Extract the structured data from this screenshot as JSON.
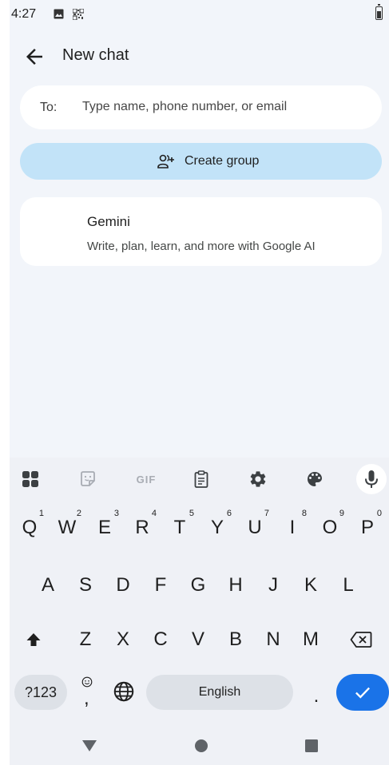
{
  "status_bar": {
    "time": "4:27",
    "icons": [
      "image-icon",
      "qr-code-icon",
      "battery-icon"
    ]
  },
  "app_bar": {
    "title": "New chat",
    "back_icon": "arrow-back-icon"
  },
  "recipient": {
    "label": "To:",
    "value": "",
    "placeholder": "Type name, phone number, or email"
  },
  "create_group": {
    "label": "Create group",
    "icon": "group-add-icon"
  },
  "suggestions": [
    {
      "name": "Gemini",
      "description": "Write, plan, learn, and more with Google AI"
    }
  ],
  "keyboard": {
    "toolbar": {
      "gif_label": "GIF",
      "items": [
        "apps-grid-icon",
        "sticker-icon",
        "gif-button",
        "clipboard-icon",
        "settings-icon",
        "palette-icon",
        "mic-icon"
      ]
    },
    "row1": [
      {
        "key": "Q",
        "hint": "1"
      },
      {
        "key": "W",
        "hint": "2"
      },
      {
        "key": "E",
        "hint": "3"
      },
      {
        "key": "R",
        "hint": "4"
      },
      {
        "key": "T",
        "hint": "5"
      },
      {
        "key": "Y",
        "hint": "6"
      },
      {
        "key": "U",
        "hint": "7"
      },
      {
        "key": "I",
        "hint": "8"
      },
      {
        "key": "O",
        "hint": "9"
      },
      {
        "key": "P",
        "hint": "0"
      }
    ],
    "row2": [
      "A",
      "S",
      "D",
      "F",
      "G",
      "H",
      "J",
      "K",
      "L"
    ],
    "row3": [
      "Z",
      "X",
      "C",
      "V",
      "B",
      "N",
      "M"
    ],
    "symbols_label": "?123",
    "comma_label": ",",
    "space_label": "English",
    "period_label": ".",
    "colors": {
      "enter": "#1a73e8",
      "keyboard_bg": "#eff1f6",
      "create_group_bg": "#c2e3f8"
    }
  },
  "nav_bar": {
    "items": [
      "back-triangle-icon",
      "home-circle-icon",
      "recents-square-icon"
    ]
  }
}
